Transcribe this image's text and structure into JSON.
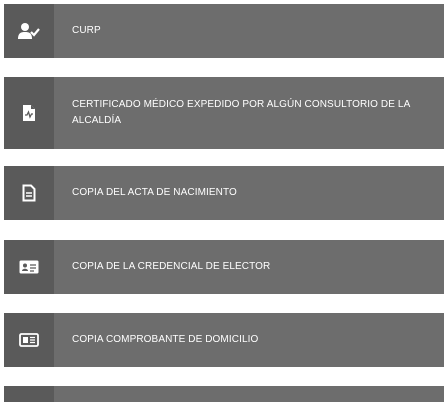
{
  "requirements": {
    "items": [
      {
        "label": "CURP",
        "icon": "user-check-icon"
      },
      {
        "label": "CERTIFICADO MÉDICO EXPEDIDO POR ALGÚN CONSULTORIO DE LA ALCALDÍA",
        "icon": "medical-document-icon"
      },
      {
        "label": "COPIA DEL ACTA DE NACIMIENTO",
        "icon": "document-icon"
      },
      {
        "label": "COPIA DE LA CREDENCIAL DE ELECTOR",
        "icon": "id-card-icon"
      },
      {
        "label": "COPIA COMPROBANTE DE DOMICILIO",
        "icon": "newspaper-icon"
      },
      {
        "label": "",
        "icon": ""
      }
    ]
  },
  "colors": {
    "row_bg": "#6d6d6d",
    "icon_bg": "#5a5a5a",
    "text": "#ffffff"
  }
}
